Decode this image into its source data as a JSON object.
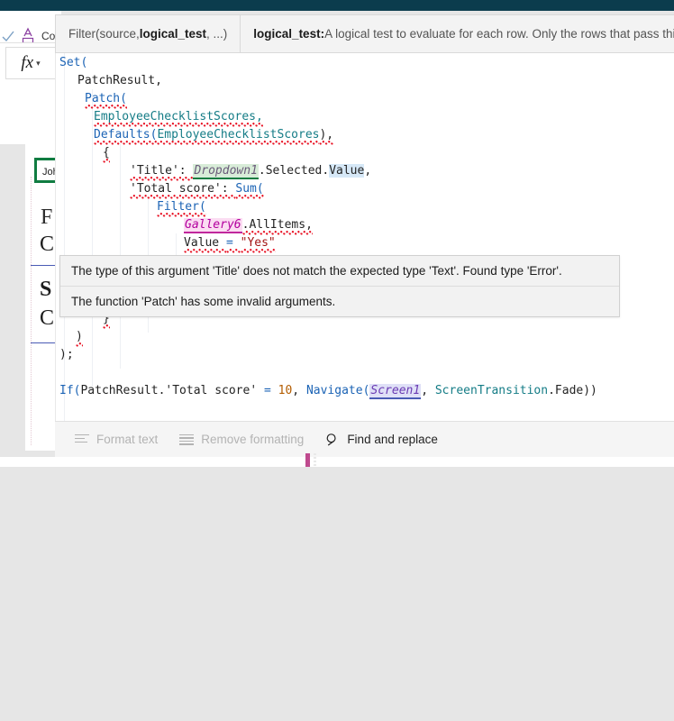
{
  "app": {
    "header_color": "#0b3c4d",
    "accent_green": "#107c41",
    "accent_magenta": "#bf4a8e"
  },
  "toolbar": {
    "font_color_icon": "font-color-icon",
    "check_icon": "checkmark-icon",
    "truncated_label": "Co",
    "fx_label": "fx",
    "fx_caret": "chevron-down-icon"
  },
  "canvas": {
    "dropdown_value": "Joh",
    "labels": [
      "F",
      "C",
      "S",
      "C"
    ]
  },
  "intellisense": {
    "signature_prefix": "Filter(source, ",
    "signature_param": "logical_test",
    "signature_suffix": ", ...)",
    "description_param": "logical_test:",
    "description_text": " A logical test to evaluate for each row. Only the rows that pass this test will"
  },
  "formula": {
    "lines": [
      {
        "indent": 0,
        "text": "Set("
      },
      {
        "indent": 1,
        "text": "PatchResult,"
      },
      {
        "indent": 1,
        "text": "Patch("
      },
      {
        "indent": 2,
        "text": "EmployeeChecklistScores,"
      },
      {
        "indent": 2,
        "text": "Defaults(EmployeeChecklistScores),"
      },
      {
        "indent": 2,
        "text": "{"
      },
      {
        "indent": 3,
        "text": "'Title': Dropdown1.Selected.Value,"
      },
      {
        "indent": 3,
        "text": "'Total score': Sum("
      },
      {
        "indent": 4,
        "text": "Filter("
      },
      {
        "indent": 5,
        "text": "Gallery6.AllItems,"
      },
      {
        "indent": 5,
        "text": "Value = \"Yes\""
      },
      {
        "indent": 4,
        "text": ")"
      },
      {
        "indent": 3,
        "text": ")"
      },
      {
        "indent": 2,
        "text": "}"
      },
      {
        "indent": 1,
        "text": ")"
      },
      {
        "indent": 0,
        "text": ");"
      },
      {
        "indent": 0,
        "text": ""
      },
      {
        "indent": 0,
        "text": "If(PatchResult.'Total score' = 10, Navigate(Screen1, ScreenTransition.Fade))"
      }
    ],
    "tokens": {
      "set": "Set(",
      "patch_result": "PatchResult,",
      "patch": "Patch(",
      "table_name": "EmployeeChecklistScores,",
      "defaults": "Defaults(",
      "defaults_arg": "EmployeeChecklistScores",
      "defaults_close": "),",
      "open_brace": "{",
      "title_key": "'Title': ",
      "dropdown_ctrl": "Dropdown1",
      "dropdown_prop": ".Selected.",
      "dropdown_value": "Value",
      "title_comma": ",",
      "total_key": "'Total score': ",
      "sum": "Sum(",
      "filter": "Filter(",
      "gallery_ctrl": "Gallery6",
      "gallery_prop": ".AllItems,",
      "value_word": "Value ",
      "eq": "= ",
      "yes_str": "\"Yes\"",
      "close_paren": ")",
      "close_brace": "}",
      "semicolon": ");",
      "if_open": "If(",
      "patchresult_ref": "PatchResult.'Total score' ",
      "eq2": "= ",
      "ten": "10",
      "comma_sp": ", ",
      "navigate": "Navigate(",
      "screen_ctrl": "Screen1",
      "screen_comma": ", ",
      "screentransition": "ScreenTransition",
      "fade": ".Fade))"
    }
  },
  "errors": [
    "The type of this argument 'Title' does not match the expected type 'Text'. Found type 'Error'.",
    "The function 'Patch' has some invalid arguments."
  ],
  "bottom_toolbar": {
    "format_text": "Format text",
    "remove_formatting": "Remove formatting",
    "find_and_replace": "Find and replace"
  }
}
